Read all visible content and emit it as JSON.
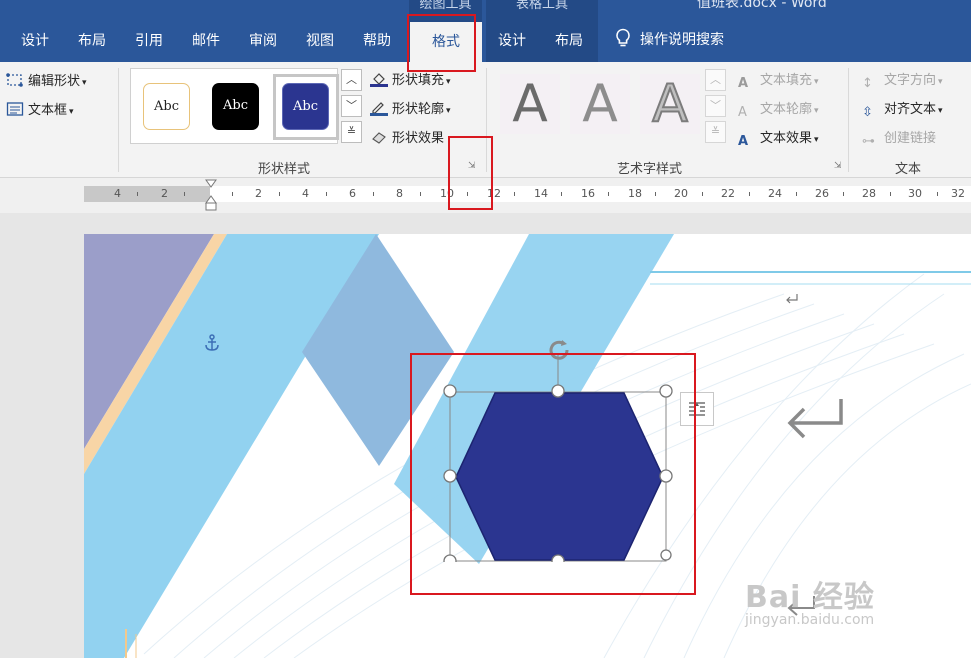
{
  "window": {
    "doc_title": "值班表.docx - Word",
    "ctx_drawing_label": "绘图工具",
    "ctx_table_label": "表格工具"
  },
  "tabs": [
    {
      "label": "设计"
    },
    {
      "label": "布局"
    },
    {
      "label": "引用"
    },
    {
      "label": "邮件"
    },
    {
      "label": "审阅"
    },
    {
      "label": "视图"
    },
    {
      "label": "帮助"
    }
  ],
  "active_tab": "格式",
  "table_tabs": [
    {
      "label": "设计"
    },
    {
      "label": "布局"
    }
  ],
  "tellme": "操作说明搜索",
  "ribbon": {
    "edit_shape": "编辑形状",
    "text_box": "文本框",
    "shape_styles_label": "形状样式",
    "style_sample": "Abc",
    "shape_fill": "形状填充",
    "shape_outline": "形状轮廓",
    "shape_effects": "形状效果",
    "wordart_label": "艺术字样式",
    "wordart_sample": "A",
    "text_fill": "文本填充",
    "text_outline": "文本轮廓",
    "text_effects": "文本效果",
    "text_direction": "文字方向",
    "align_text": "对齐文本",
    "create_link": "创建链接",
    "text_group_label": "文本"
  },
  "ruler": {
    "numbers": [
      "4",
      "2",
      "2",
      "4",
      "6",
      "8",
      "10",
      "12",
      "14",
      "16",
      "18",
      "20",
      "22",
      "24",
      "26",
      "28",
      "30",
      "32"
    ]
  },
  "watermark": {
    "brand": "Bai 经验",
    "url": "jingyan.baidu.com"
  },
  "colors": {
    "accent": "#2b579a",
    "hexagon_fill": "#2b3590",
    "annotation": "#d9181f",
    "light_blue": "#92d2f0"
  }
}
